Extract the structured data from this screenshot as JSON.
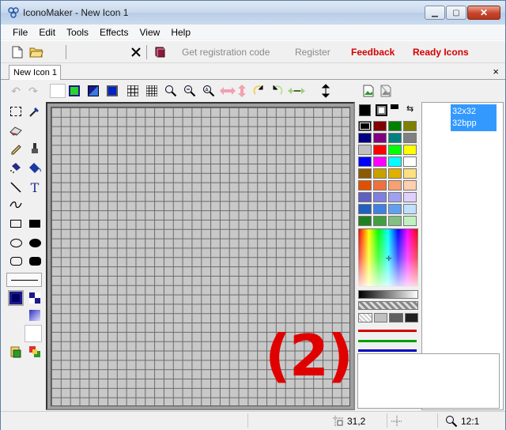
{
  "window": {
    "title": "IconoMaker - New Icon 1",
    "controls": [
      "minimize",
      "maximize",
      "close"
    ]
  },
  "menu": [
    "File",
    "Edit",
    "Tools",
    "Effects",
    "View",
    "Help"
  ],
  "toolbar": {
    "links": {
      "get_code": "Get registration code",
      "register": "Register",
      "feedback": "Feedback",
      "ready_icons": "Ready Icons"
    }
  },
  "tabs": {
    "active": "New Icon 1",
    "close_glyph": "×"
  },
  "canvas": {
    "grid_cells": 32,
    "annotation": "(2)"
  },
  "palette": {
    "colors": [
      [
        "#000000",
        "#800000",
        "#008000",
        "#808000"
      ],
      [
        "#000080",
        "#800080",
        "#008080",
        "#808080"
      ],
      [
        "#c0c0c0",
        "#ff0000",
        "#00ff00",
        "#ffff00"
      ],
      [
        "#0000ff",
        "#ff00ff",
        "#00ffff",
        "#ffffff"
      ],
      [
        "#8b5a00",
        "#c8a000",
        "#e0b000",
        "#ffe080"
      ],
      [
        "#e05000",
        "#f07040",
        "#f8a070",
        "#ffd0b0"
      ],
      [
        "#6060c0",
        "#8080e0",
        "#a0a0f0",
        "#e0d0ff"
      ],
      [
        "#2060c0",
        "#4080e0",
        "#60a0f0",
        "#c0e0ff"
      ],
      [
        "#208020",
        "#40a040",
        "#80c080",
        "#c0f0c0"
      ]
    ],
    "primary": "#000000",
    "secondary": "#ffffff"
  },
  "preview": {
    "size": "32x32",
    "depth": "32bpp"
  },
  "status": {
    "coords": "31,2",
    "zoom": "12:1"
  }
}
